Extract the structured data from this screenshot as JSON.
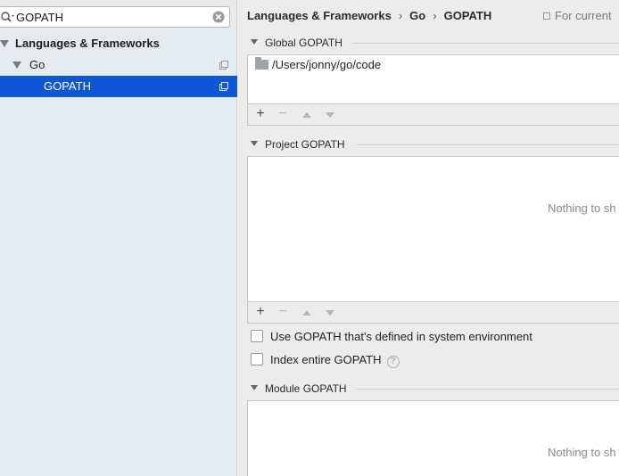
{
  "search": {
    "value": "GOPATH"
  },
  "tree": {
    "items": [
      {
        "label": "Languages & Frameworks"
      },
      {
        "label": "Go"
      },
      {
        "label": "GOPATH"
      }
    ]
  },
  "header": {
    "breadcrumb": [
      "Languages & Frameworks",
      "Go",
      "GOPATH"
    ],
    "scope": "For current"
  },
  "global_gopath": {
    "title": "Global GOPATH",
    "paths": [
      "/Users/jonny/go/code"
    ]
  },
  "project_gopath": {
    "title": "Project GOPATH",
    "empty_text": "Nothing to sh"
  },
  "toolbar": {
    "add": "+",
    "remove": "−"
  },
  "options": {
    "use_system_env": {
      "label": "Use GOPATH that's defined in system environment",
      "checked": false
    },
    "index_entire": {
      "label": "Index entire GOPATH",
      "checked": false
    }
  },
  "module_gopath": {
    "title": "Module GOPATH",
    "empty_text": "Nothing to sh"
  },
  "colors": {
    "selection": "#0f57d5"
  }
}
